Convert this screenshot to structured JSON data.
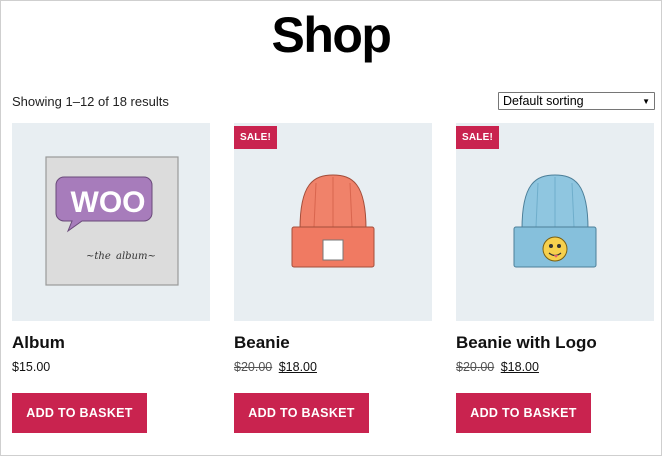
{
  "page": {
    "title": "Shop",
    "result_count": "Showing 1–12 of 18 results",
    "sorting": {
      "selected": "Default sorting",
      "icon": "chevron-down-icon"
    }
  },
  "products": [
    {
      "name": "Album",
      "badge": "",
      "price": "$15.00",
      "old_price": "",
      "button": "ADD TO BASKET",
      "image": "album-image"
    },
    {
      "name": "Beanie",
      "badge": "SALE!",
      "price": "$18.00",
      "old_price": "$20.00",
      "button": "ADD TO BASKET",
      "image": "beanie-image"
    },
    {
      "name": "Beanie with Logo",
      "badge": "SALE!",
      "price": "$18.00",
      "old_price": "$20.00",
      "button": "ADD TO BASKET",
      "image": "beanie-with-logo-image"
    }
  ],
  "colors": {
    "accent": "#c9234f",
    "thumb_bg": "#e8eef2",
    "beanie": "#f0826a",
    "beanie_logo": "#8fc6e0"
  }
}
